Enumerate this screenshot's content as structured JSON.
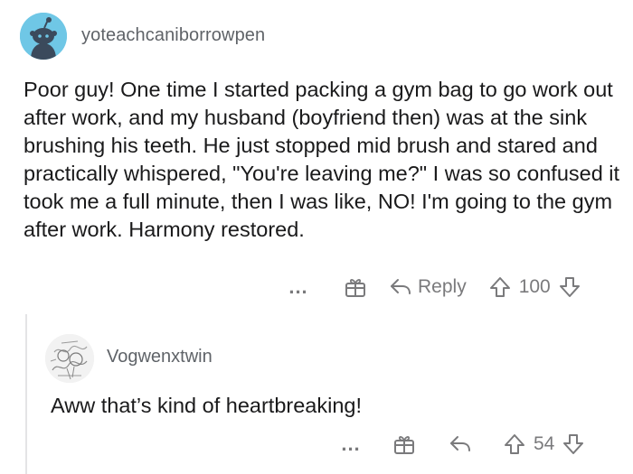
{
  "comment": {
    "username": "yoteachcaniborrowpen",
    "body": "Poor guy! One time I started packing a gym bag to go work out after work, and my husband (boyfriend then) was at the sink brushing his teeth. He just stopped mid brush and stared and practically whispered, \"You're leaving me?\" I was so confused it took me a full minute, then I was like, NO! I'm going to the gym after work. Harmony restored.",
    "actions": {
      "more_label": "...",
      "reply_label": "Reply",
      "score": "100"
    }
  },
  "reply": {
    "username": "Vogwenxtwin",
    "body": "Aww that’s kind of heartbreaking!",
    "actions": {
      "more_label": "...",
      "score": "54"
    }
  },
  "icons": {
    "avatar_default": "reddit-snoo-avatar",
    "avatar_sketch": "sketch-avatar",
    "gift": "gift-icon",
    "reply": "reply-arrow-icon",
    "upvote": "upvote-arrow-icon",
    "downvote": "downvote-arrow-icon"
  },
  "colors": {
    "avatar_bg": "#6fc7e6",
    "text": "#1a1a1b",
    "muted": "#7a7a7c"
  }
}
